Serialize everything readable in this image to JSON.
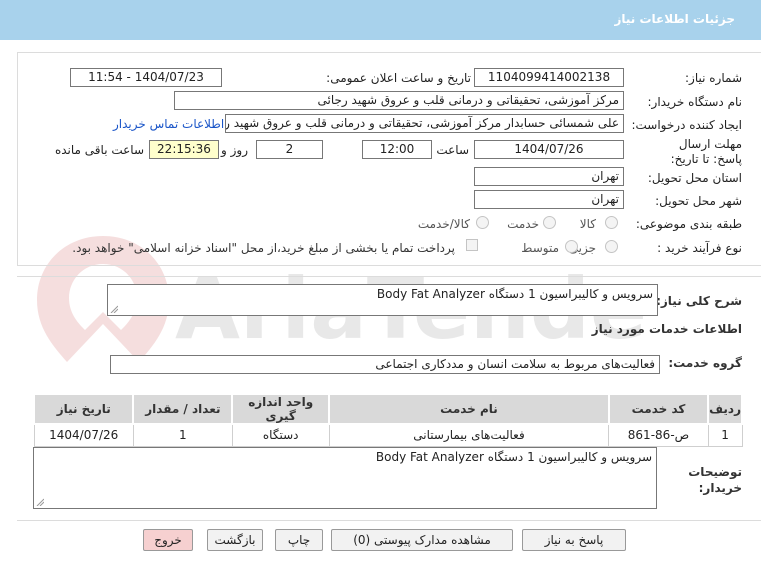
{
  "header": {
    "title": "جزئیات اطلاعات نیاز"
  },
  "form": {
    "need_number_label": "شماره نیاز:",
    "need_number": "1104099414002138",
    "announce_label": "تاریخ و ساعت اعلان عمومی:",
    "announce_value": "1404/07/23 - 11:54",
    "buyer_org_label": "نام دستگاه خریدار:",
    "buyer_org": "مرکز آموزشی، تحقیقاتی و درمانی قلب و عروق شهید رجائی",
    "requester_label": "ایجاد کننده درخواست:",
    "requester": "علی شمسائی حسابدار مرکز آموزشی، تحقیقاتی و درمانی قلب و عروق شهید رجائی",
    "contact_link": "اطلاعات تماس خریدار",
    "deadline_label": "مهلت ارسال پاسخ: تا تاریخ:",
    "deadline_date": "1404/07/26",
    "time_label": "ساعت",
    "deadline_time": "12:00",
    "days_value": "2",
    "days_label": "روز و",
    "remaining_time": "22:15:36",
    "remaining_label": "ساعت باقی مانده",
    "province_label": "استان محل تحویل:",
    "province": "تهران",
    "city_label": "شهر محل تحویل:",
    "city": "تهران",
    "category_label": "طبقه بندی موضوعی:",
    "category_options": [
      "کالا",
      "خدمت",
      "کالا/خدمت"
    ],
    "process_label": "نوع فرآیند خرید :",
    "process_options": [
      "جزیی",
      "متوسط"
    ],
    "payment_note": "پرداخت تمام یا بخشی از مبلغ خرید،از محل \"اسناد خزانه اسلامی\" خواهد بود."
  },
  "summary": {
    "label": "شرح کلی نیاز:",
    "value": "سرویس و کالیبراسیون 1 دستگاه Body Fat Analyzer"
  },
  "services": {
    "section_title": "اطلاعات خدمات مورد نیاز",
    "group_label": "گروه خدمت:",
    "group_value": "فعالیت‌های مربوط به سلامت انسان و مددکاری اجتماعی",
    "columns": [
      "ردیف",
      "کد خدمت",
      "نام خدمت",
      "واحد اندازه گیری",
      "تعداد / مقدار",
      "تاریخ نیاز"
    ],
    "rows": [
      [
        "1",
        "ص-86-861",
        "فعالیت‌های بیمارستانی",
        "دستگاه",
        "1",
        "1404/07/26"
      ]
    ]
  },
  "notes": {
    "label": "توضیحات خریدار:",
    "value": "سرویس و کالیبراسیون 1 دستگاه Body Fat Analyzer"
  },
  "buttons": {
    "reply": "پاسخ به نیاز",
    "attachments": "مشاهده مدارک پیوستی (0)",
    "print": "چاپ",
    "back": "بازگشت",
    "exit": "خروج"
  },
  "watermark": {
    "text": "AriaTender.net"
  },
  "colors": {
    "header": "#a8d2ec",
    "link": "#1a55c8",
    "highlight": "#ffffcc",
    "exit_button": "#f6d0d0"
  }
}
